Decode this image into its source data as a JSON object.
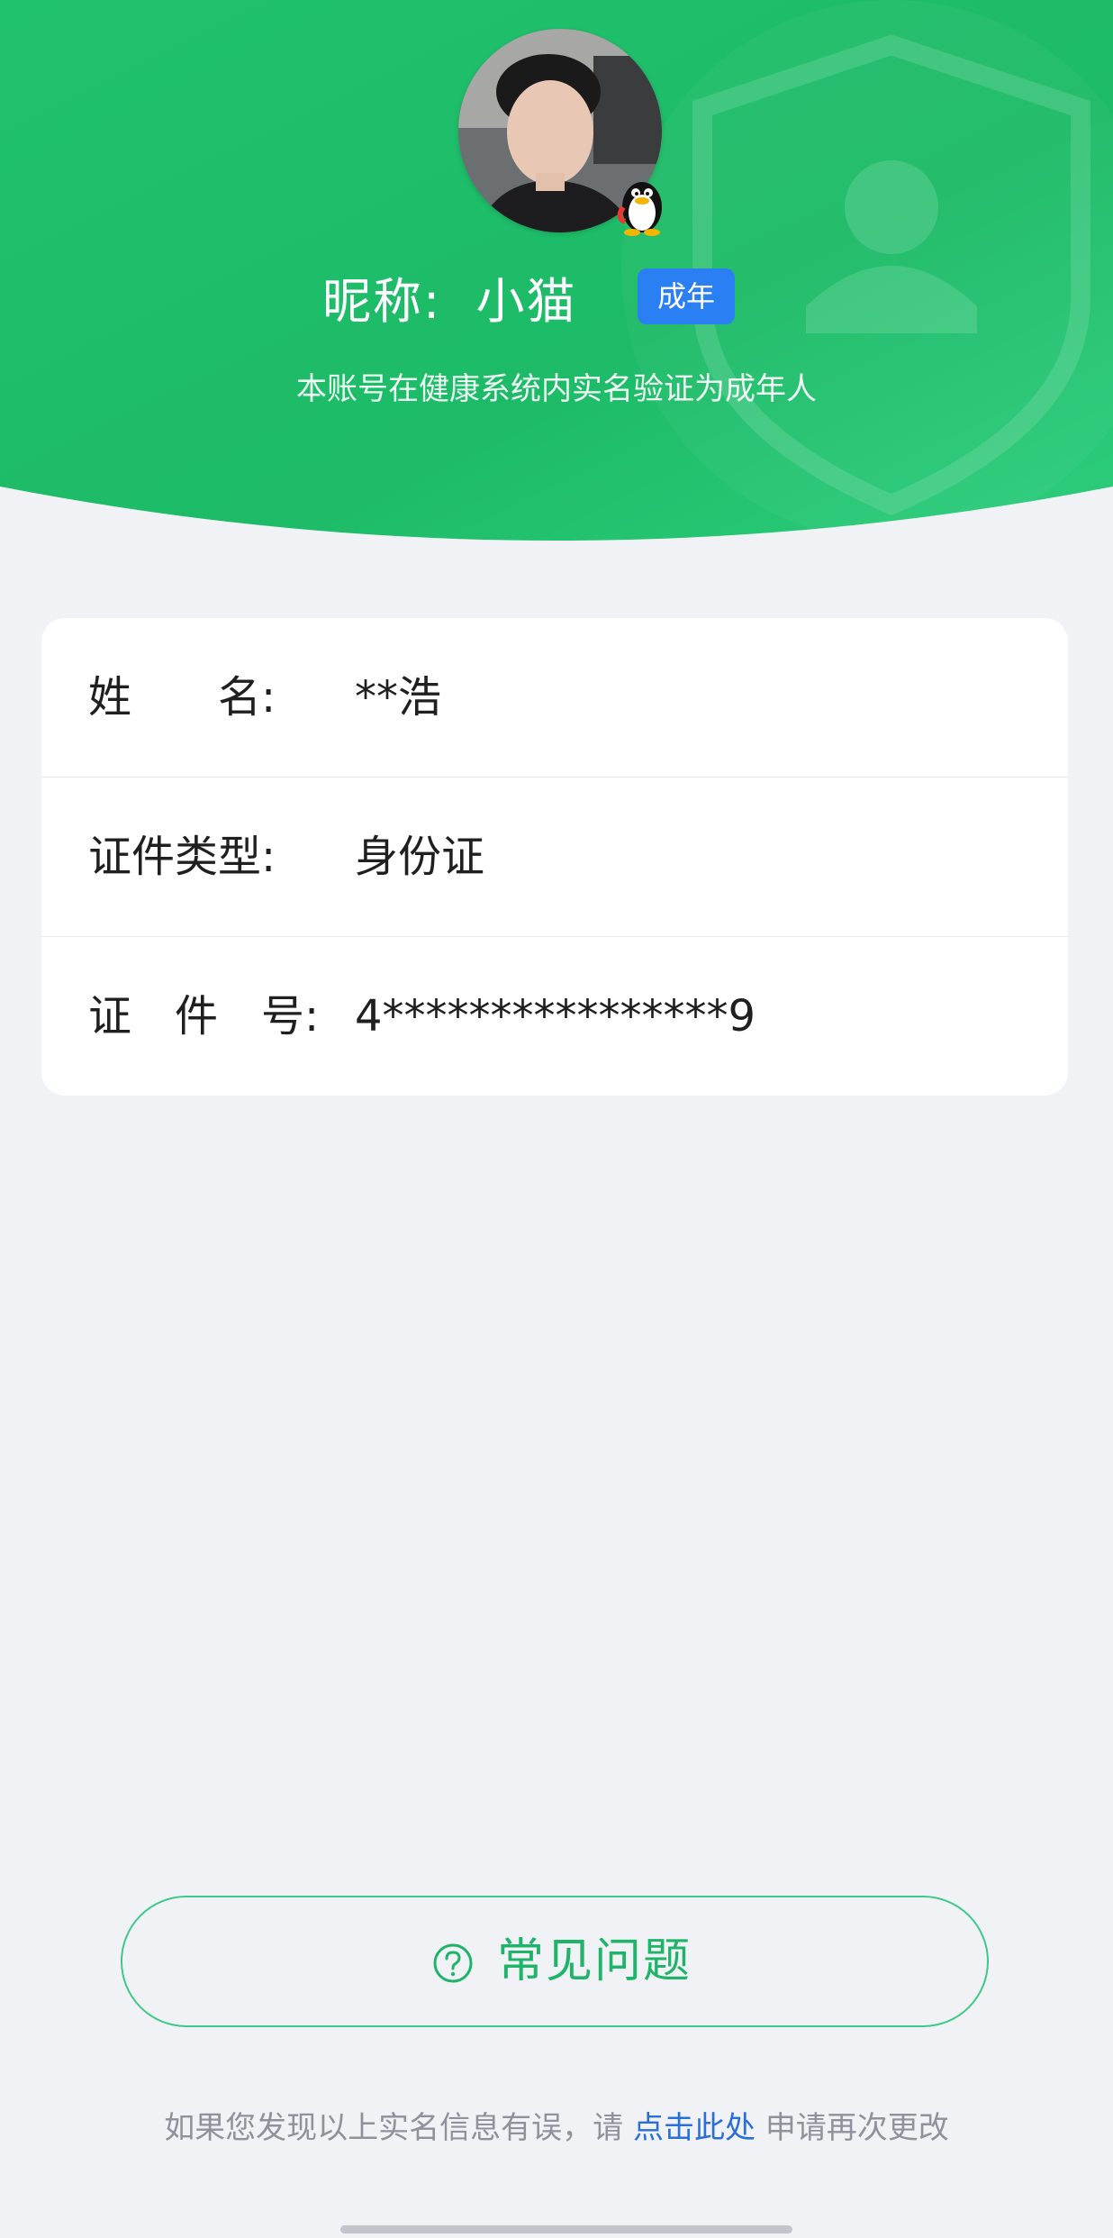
{
  "profile": {
    "nickname_label": "昵称:",
    "nickname_value": "小猫",
    "badge": "成年",
    "subtitle": "本账号在健康系统内实名验证为成年人"
  },
  "info_rows": [
    {
      "label": "姓　　名:",
      "value": "**浩"
    },
    {
      "label": "证件类型:",
      "value": "身份证"
    },
    {
      "label": "证　件　号:",
      "value": "4****************9"
    }
  ],
  "faq": {
    "label": "常见问题",
    "icon": "question-circle-icon"
  },
  "footer": {
    "prefix": "如果您发现以上实名信息有误，请",
    "link": "点击此处",
    "suffix": "申请再次更改"
  },
  "icons": {
    "avatar_badge": "qq-penguin-icon",
    "header_decoration": "shield-user-icon"
  },
  "colors": {
    "primary_green": "#1fbf6a",
    "badge_blue": "#2a7ff2",
    "link_blue": "#2a6fd8",
    "page_bg": "#f0f2f6"
  }
}
